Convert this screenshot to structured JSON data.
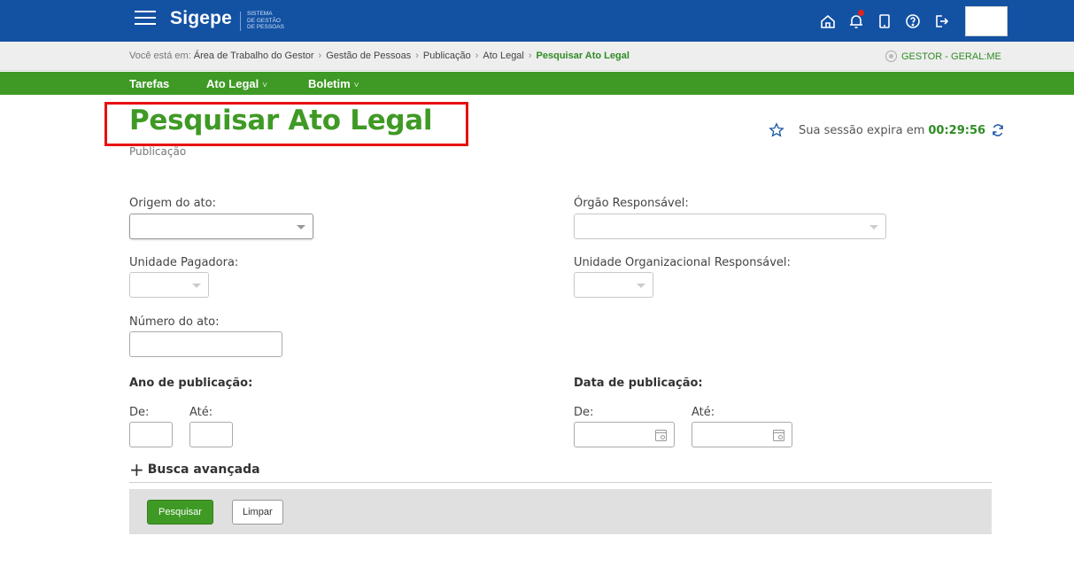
{
  "header": {
    "logo": "Sigepe",
    "logo_sub_1": "SISTEMA",
    "logo_sub_2": "DE GESTÃO",
    "logo_sub_3": "DE PESSOAS",
    "icons": [
      "home-icon",
      "bell-icon",
      "tablet-icon",
      "help-icon",
      "logout-icon"
    ],
    "accent": "#1351a3"
  },
  "breadcrumb": {
    "prefix": "Você está em:",
    "items": [
      "Área de Trabalho do Gestor",
      "Gestão de Pessoas",
      "Publicação",
      "Ato Legal"
    ],
    "current": "Pesquisar Ato Legal",
    "separator": "›"
  },
  "profile": {
    "label": "GESTOR - GERAL:ME"
  },
  "nav": {
    "items": [
      {
        "label": "Tarefas"
      },
      {
        "label": "Ato Legal",
        "chevron": "˅"
      },
      {
        "label": "Boletim",
        "chevron": "˅"
      }
    ],
    "color": "#3f9a25"
  },
  "page": {
    "title": "Pesquisar Ato Legal",
    "subtitle": "Publicação",
    "title_color": "#3f9a25",
    "highlight_color": "#e8100f"
  },
  "session": {
    "text": "Sua sessão expira em",
    "timer": "00:29:56"
  },
  "form": {
    "origem_label": "Origem do ato:",
    "origem_value": "",
    "orgao_label": "Órgão Responsável:",
    "unidade_pagadora_label": "Unidade Pagadora:",
    "unidade_org_label": "Unidade Organizacional Responsável:",
    "numero_label": "Número do ato:",
    "numero_value": "",
    "ano_label": "Ano de publicação:",
    "ano_de_label": "De:",
    "ano_ate_label": "Até:",
    "data_label": "Data de publicação:",
    "data_de_label": "De:",
    "data_ate_label": "Até:"
  },
  "advanced": {
    "plus": "+",
    "label": "Busca avançada"
  },
  "actions": {
    "search": "Pesquisar",
    "clear": "Limpar"
  }
}
